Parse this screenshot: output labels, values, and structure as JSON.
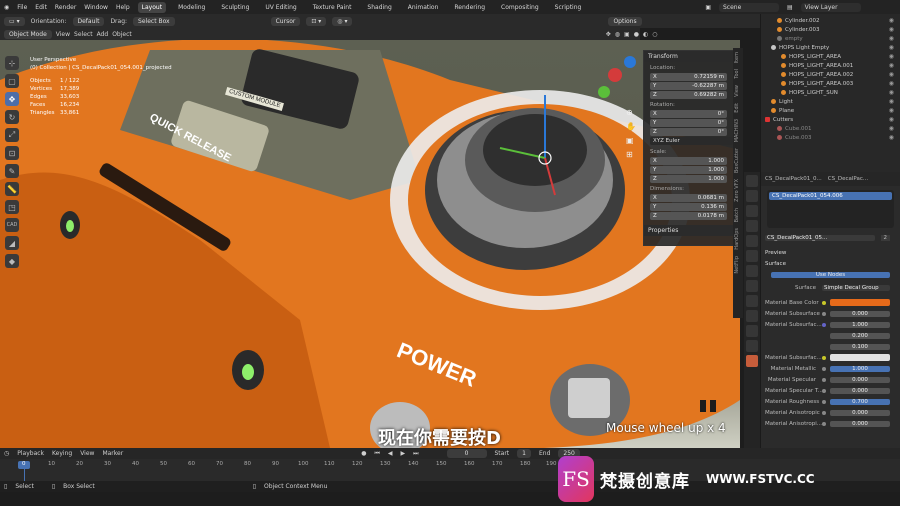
{
  "menubar": {
    "items": [
      "File",
      "Edit",
      "Render",
      "Window",
      "Help"
    ],
    "workspaces": [
      "Layout",
      "Modeling",
      "Sculpting",
      "UV Editing",
      "Texture Paint",
      "Shading",
      "Animation",
      "Rendering",
      "Compositing",
      "Scripting"
    ],
    "active_workspace": "Layout",
    "scene": "Scene",
    "view_layer": "View Layer"
  },
  "header2": {
    "orientation_label": "Orientation:",
    "orientation_value": "Default",
    "drag_label": "Drag:",
    "drag_value": "Select Box",
    "pivot_value": "Cursor",
    "options_label": "Options"
  },
  "header3": {
    "mode": "Object Mode",
    "menus": [
      "View",
      "Select",
      "Add",
      "Object"
    ]
  },
  "viewport": {
    "info_lines": [
      "User Perspective",
      "(0) Collection | CS_DecalPack01_054.001_projected"
    ],
    "stats": [
      {
        "label": "Objects",
        "value": "1 / 122"
      },
      {
        "label": "Vertices",
        "value": "17,389"
      },
      {
        "label": "Edges",
        "value": "33,603"
      },
      {
        "label": "Faces",
        "value": "16,234"
      },
      {
        "label": "Triangles",
        "value": "33,861"
      }
    ],
    "model_text": [
      "QUICK RELEASE",
      "CUSTOM MODULE",
      "POWER"
    ],
    "tools": [
      "cursor",
      "select",
      "move",
      "rotate",
      "scale",
      "transform",
      "annotate",
      "measure",
      "add-cube",
      "cad",
      "bevel",
      "hops"
    ]
  },
  "npanel": {
    "section_transform": "Transform",
    "location_label": "Location:",
    "location": [
      {
        "axis": "X",
        "value": "0.72159 m"
      },
      {
        "axis": "Y",
        "value": "-0.62287 m"
      },
      {
        "axis": "Z",
        "value": "0.69282 m"
      }
    ],
    "rotation_label": "Rotation:",
    "rotation": [
      {
        "axis": "X",
        "value": "0°"
      },
      {
        "axis": "Y",
        "value": "0°"
      },
      {
        "axis": "Z",
        "value": "0°"
      }
    ],
    "rotation_mode": "XYZ Euler",
    "scale_label": "Scale:",
    "scale": [
      {
        "axis": "X",
        "value": "1.000"
      },
      {
        "axis": "Y",
        "value": "1.000"
      },
      {
        "axis": "Z",
        "value": "1.000"
      }
    ],
    "dimensions_label": "Dimensions:",
    "dimensions": [
      {
        "axis": "X",
        "value": "0.0681 m"
      },
      {
        "axis": "Y",
        "value": "0.136 m"
      },
      {
        "axis": "Z",
        "value": "0.0178 m"
      }
    ],
    "section_properties": "Properties",
    "side_tabs": [
      "Item",
      "Tool",
      "View",
      "Edit",
      "MACHIN3",
      "BoxCutter",
      "Zero VFX",
      "Batch",
      "HardOps",
      "NetFlip"
    ]
  },
  "outliner": {
    "items": [
      {
        "name": "Cylinder.002",
        "dim": false
      },
      {
        "name": "Cylinder.003",
        "dim": false
      },
      {
        "name": "empty",
        "dim": true
      },
      {
        "name": "HOPS Light Empty",
        "dim": false
      },
      {
        "name": "HOPS_LIGHT_AREA",
        "dim": false
      },
      {
        "name": "HOPS_LIGHT_AREA.001",
        "dim": false
      },
      {
        "name": "HOPS_LIGHT_AREA.002",
        "dim": false
      },
      {
        "name": "HOPS_LIGHT_AREA.003",
        "dim": false
      },
      {
        "name": "HOPS_LIGHT_SUN",
        "dim": false
      },
      {
        "name": "Light",
        "dim": false
      },
      {
        "name": "Plane",
        "dim": false
      },
      {
        "name": "Cutters",
        "dim": false
      },
      {
        "name": "Cube.001",
        "dim": true
      },
      {
        "name": "Cube.003",
        "dim": true
      }
    ]
  },
  "properties": {
    "header_object": "CS_DecalPack01_0...",
    "header_material": "CS_DecalPac...",
    "slot_name": "CS_DecalPack01_054.006",
    "material_name": "CS_DecalPack01_05...",
    "user_count": "2",
    "preview_label": "Preview",
    "surface_label": "Surface",
    "use_nodes_label": "Use Nodes",
    "surface_field_label": "Surface",
    "surface_value": "Simple Decal Group",
    "inputs": [
      {
        "label": "Material Base Color",
        "value": "",
        "style": "orange"
      },
      {
        "label": "Material Subsurface",
        "value": "0.000",
        "style": ""
      },
      {
        "label": "Material Subsurfac...",
        "value": "1.000",
        "style": ""
      },
      {
        "label": "",
        "value": "0.200",
        "style": ""
      },
      {
        "label": "",
        "value": "0.100",
        "style": ""
      },
      {
        "label": "Material Subsurfac...",
        "value": "",
        "style": "white"
      },
      {
        "label": "Material Metallic",
        "value": "1.000",
        "style": "blue"
      },
      {
        "label": "Material Specular",
        "value": "0.000",
        "style": ""
      },
      {
        "label": "Material Specular T...",
        "value": "0.000",
        "style": ""
      },
      {
        "label": "Material Roughness",
        "value": "0.700",
        "style": "blue"
      },
      {
        "label": "Material Anisotropic",
        "value": "0.000",
        "style": ""
      },
      {
        "label": "Material Anisotropi...",
        "value": "0.000",
        "style": ""
      }
    ]
  },
  "timeline": {
    "menus": [
      "Playback",
      "Keying",
      "View",
      "Marker"
    ],
    "current_frame": "0",
    "start_label": "Start",
    "start_value": "1",
    "end_label": "End",
    "end_value": "250",
    "ticks": [
      "0",
      "10",
      "20",
      "30",
      "40",
      "50",
      "60",
      "70",
      "80",
      "90",
      "100",
      "110",
      "120",
      "130",
      "140",
      "150",
      "160",
      "170",
      "180",
      "190"
    ]
  },
  "statusbar": {
    "items": [
      "Select",
      "Box Select",
      "Object Context Menu"
    ]
  },
  "overlay": {
    "subtitle": "现在你需要按D",
    "keycast": "Mouse wheel up x 4",
    "watermark_logo": "FS",
    "watermark_cn": "梵摄创意库",
    "watermark_url": "WWW.FSTVC.CC"
  },
  "colors": {
    "accent": "#4772b3",
    "body_orange": "#e2761f",
    "active_tab": "#c75d3b"
  }
}
